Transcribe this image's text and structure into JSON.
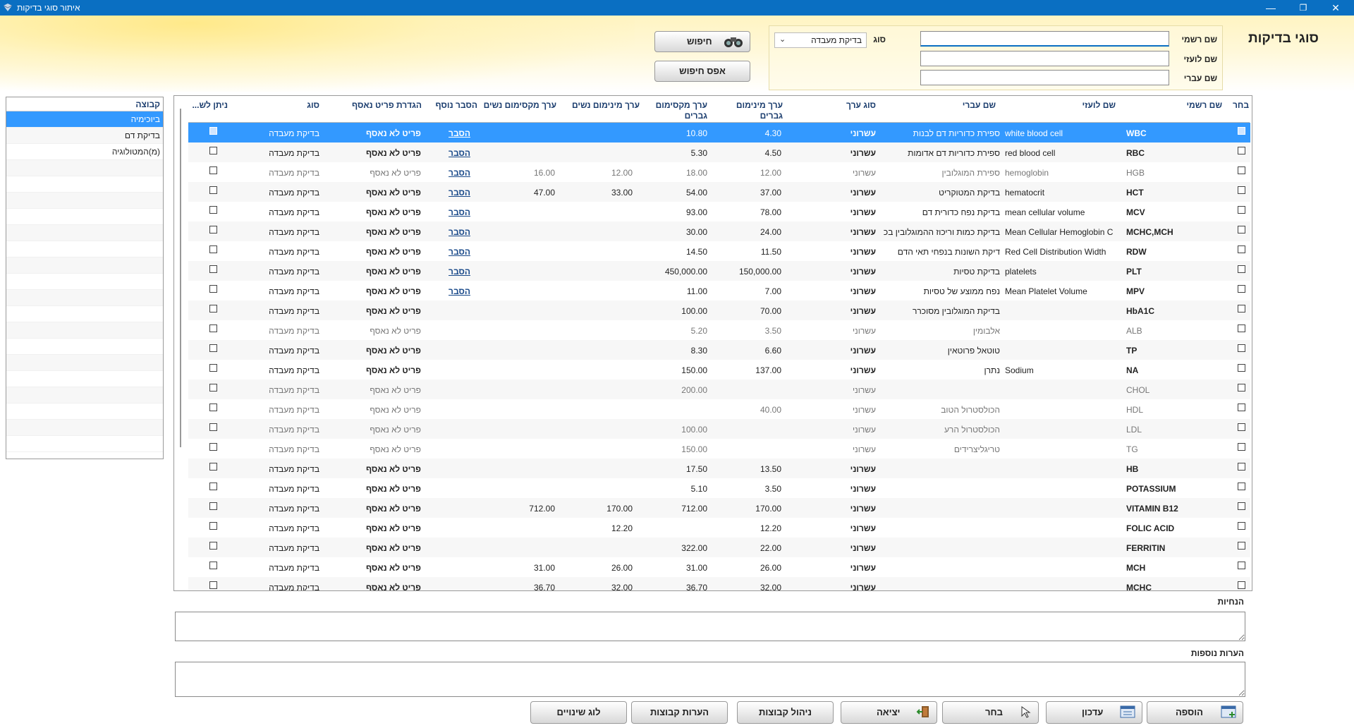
{
  "window": {
    "title": "איתור סוגי בדיקות",
    "minimize": "—",
    "maximize": "❐",
    "close": "✕"
  },
  "header": {
    "page_title": "סוגי בדיקות",
    "search": {
      "official_name_label": "שם רשמי",
      "foreign_name_label": "שם לועזי",
      "hebrew_name_label": "שם עברי",
      "type_label": "סוג",
      "type_value": "בדיקת מעבדה",
      "official_name_value": "",
      "foreign_name_value": "",
      "hebrew_name_value": ""
    },
    "search_button": "חיפוש",
    "reset_button": "אפס חיפוש"
  },
  "groups": {
    "header": "קבוצה",
    "items": [
      {
        "label": "ביוכימיה",
        "selected": true
      },
      {
        "label": "בדיקת דם",
        "selected": false
      },
      {
        "label": "(מ)המטולוגיה",
        "selected": false
      }
    ]
  },
  "grid": {
    "columns": {
      "select": "בחר",
      "official_name": "שם רשמי",
      "foreign_name": "שם לועזי",
      "hebrew_name": "שם עברי",
      "value_type": "סוג ערך",
      "min_men": "ערך מינימום גברים",
      "max_men": "ערך מקסימום גברים",
      "min_women": "ערך מינימום נשים",
      "max_women": "ערך מקסימום נשים",
      "extra_explain": "הסבר נוסף",
      "extra_item_def": "הגדרת פריט נאסף",
      "type": "סוג",
      "can_send": "ניתן לש..."
    },
    "rows": [
      {
        "official": "WBC",
        "foreign": "white blood cell",
        "hebrew": "ספירת כדוריות דם לבנות",
        "vtype": "עשרוני",
        "min_m": "4.30",
        "max_m": "10.80",
        "min_w": "",
        "max_w": "",
        "explain": "הסבר",
        "item": "פריט לא נאסף",
        "type": "בדיקת מעבדה",
        "dim": false,
        "sel": true
      },
      {
        "official": "RBC",
        "foreign": "red blood cell",
        "hebrew": "ספירת כדוריות דם אדומות",
        "vtype": "עשרוני",
        "min_m": "4.50",
        "max_m": "5.30",
        "min_w": "",
        "max_w": "",
        "explain": "הסבר",
        "item": "פריט לא נאסף",
        "type": "בדיקת מעבדה",
        "dim": false,
        "sel": false
      },
      {
        "official": "HGB",
        "foreign": "hemoglobin",
        "hebrew": "ספירת המוגלובין",
        "vtype": "עשרוני",
        "min_m": "12.00",
        "max_m": "18.00",
        "min_w": "12.00",
        "max_w": "16.00",
        "explain": "הסבר",
        "item": "פריט לא נאסף",
        "type": "בדיקת מעבדה",
        "dim": true,
        "sel": false
      },
      {
        "official": "HCT",
        "foreign": "hematocrit",
        "hebrew": "בדיקת המטוקריט",
        "vtype": "עשרוני",
        "min_m": "37.00",
        "max_m": "54.00",
        "min_w": "33.00",
        "max_w": "47.00",
        "explain": "הסבר",
        "item": "פריט לא נאסף",
        "type": "בדיקת מעבדה",
        "dim": false,
        "sel": false
      },
      {
        "official": "MCV",
        "foreign": "mean cellular volume",
        "hebrew": "בדיקת נפח כדורית דם",
        "vtype": "עשרוני",
        "min_m": "78.00",
        "max_m": "93.00",
        "min_w": "",
        "max_w": "",
        "explain": "הסבר",
        "item": "פריט לא נאסף",
        "type": "בדיקת מעבדה",
        "dim": false,
        "sel": false
      },
      {
        "official": "MCHC,MCH",
        "foreign": "Mean Cellular Hemoglobin C",
        "hebrew": "בדיקת כמות וריכוז ההמוגלובין בכ",
        "vtype": "עשרוני",
        "min_m": "24.00",
        "max_m": "30.00",
        "min_w": "",
        "max_w": "",
        "explain": "הסבר",
        "item": "פריט לא נאסף",
        "type": "בדיקת מעבדה",
        "dim": false,
        "sel": false
      },
      {
        "official": "RDW",
        "foreign": "Red Cell Distribution Width",
        "hebrew": "דיקת השונות בנפחי תאי הדם",
        "vtype": "עשרוני",
        "min_m": "11.50",
        "max_m": "14.50",
        "min_w": "",
        "max_w": "",
        "explain": "הסבר",
        "item": "פריט לא נאסף",
        "type": "בדיקת מעבדה",
        "dim": false,
        "sel": false
      },
      {
        "official": "PLT",
        "foreign": "platelets",
        "hebrew": "בדיקת טסיות",
        "vtype": "עשרוני",
        "min_m": "150,000.00",
        "max_m": "450,000.00",
        "min_w": "",
        "max_w": "",
        "explain": "הסבר",
        "item": "פריט לא נאסף",
        "type": "בדיקת מעבדה",
        "dim": false,
        "sel": false
      },
      {
        "official": "MPV",
        "foreign": "Mean Platelet Volume",
        "hebrew": "נפח ממוצע של טסיות",
        "vtype": "עשרוני",
        "min_m": "7.00",
        "max_m": "11.00",
        "min_w": "",
        "max_w": "",
        "explain": "הסבר",
        "item": "פריט לא נאסף",
        "type": "בדיקת מעבדה",
        "dim": false,
        "sel": false
      },
      {
        "official": "HbA1C",
        "foreign": "",
        "hebrew": "בדיקת המוגלובין מסוכרר",
        "vtype": "עשרוני",
        "min_m": "70.00",
        "max_m": "100.00",
        "min_w": "",
        "max_w": "",
        "explain": "",
        "item": "פריט לא נאסף",
        "type": "בדיקת מעבדה",
        "dim": false,
        "sel": false
      },
      {
        "official": "ALB",
        "foreign": "",
        "hebrew": "אלבומין",
        "vtype": "עשרוני",
        "min_m": "3.50",
        "max_m": "5.20",
        "min_w": "",
        "max_w": "",
        "explain": "",
        "item": "פריט לא נאסף",
        "type": "בדיקת מעבדה",
        "dim": true,
        "sel": false
      },
      {
        "official": "TP",
        "foreign": "",
        "hebrew": "טוטאל פרוטאין",
        "vtype": "עשרוני",
        "min_m": "6.60",
        "max_m": "8.30",
        "min_w": "",
        "max_w": "",
        "explain": "",
        "item": "פריט לא נאסף",
        "type": "בדיקת מעבדה",
        "dim": false,
        "sel": false
      },
      {
        "official": "NA",
        "foreign": "Sodium",
        "hebrew": "נתרן",
        "vtype": "עשרוני",
        "min_m": "137.00",
        "max_m": "150.00",
        "min_w": "",
        "max_w": "",
        "explain": "",
        "item": "פריט לא נאסף",
        "type": "בדיקת מעבדה",
        "dim": false,
        "sel": false
      },
      {
        "official": "CHOL",
        "foreign": "",
        "hebrew": "",
        "vtype": "עשרוני",
        "min_m": "",
        "max_m": "200.00",
        "min_w": "",
        "max_w": "",
        "explain": "",
        "item": "פריט לא נאסף",
        "type": "בדיקת מעבדה",
        "dim": true,
        "sel": false
      },
      {
        "official": "HDL",
        "foreign": "",
        "hebrew": "הכולסטרול הטוב",
        "vtype": "עשרוני",
        "min_m": "40.00",
        "max_m": "",
        "min_w": "",
        "max_w": "",
        "explain": "",
        "item": "פריט לא נאסף",
        "type": "בדיקת מעבדה",
        "dim": true,
        "sel": false
      },
      {
        "official": "LDL",
        "foreign": "",
        "hebrew": "הכולסטרול הרע",
        "vtype": "עשרוני",
        "min_m": "",
        "max_m": "100.00",
        "min_w": "",
        "max_w": "",
        "explain": "",
        "item": "פריט לא נאסף",
        "type": "בדיקת מעבדה",
        "dim": true,
        "sel": false
      },
      {
        "official": "TG",
        "foreign": "",
        "hebrew": "טריגליצרידים",
        "vtype": "עשרוני",
        "min_m": "",
        "max_m": "150.00",
        "min_w": "",
        "max_w": "",
        "explain": "",
        "item": "פריט לא נאסף",
        "type": "בדיקת מעבדה",
        "dim": true,
        "sel": false
      },
      {
        "official": "HB",
        "foreign": "",
        "hebrew": "",
        "vtype": "עשרוני",
        "min_m": "13.50",
        "max_m": "17.50",
        "min_w": "",
        "max_w": "",
        "explain": "",
        "item": "פריט לא נאסף",
        "type": "בדיקת מעבדה",
        "dim": false,
        "sel": false
      },
      {
        "official": "POTASSIUM",
        "foreign": "",
        "hebrew": "",
        "vtype": "עשרוני",
        "min_m": "3.50",
        "max_m": "5.10",
        "min_w": "",
        "max_w": "",
        "explain": "",
        "item": "פריט לא נאסף",
        "type": "בדיקת מעבדה",
        "dim": false,
        "sel": false
      },
      {
        "official": "VITAMIN B12",
        "foreign": "",
        "hebrew": "",
        "vtype": "עשרוני",
        "min_m": "170.00",
        "max_m": "712.00",
        "min_w": "170.00",
        "max_w": "712.00",
        "explain": "",
        "item": "פריט לא נאסף",
        "type": "בדיקת מעבדה",
        "dim": false,
        "sel": false
      },
      {
        "official": "FOLIC ACID",
        "foreign": "",
        "hebrew": "",
        "vtype": "עשרוני",
        "min_m": "12.20",
        "max_m": "",
        "min_w": "12.20",
        "max_w": "",
        "explain": "",
        "item": "פריט לא נאסף",
        "type": "בדיקת מעבדה",
        "dim": false,
        "sel": false
      },
      {
        "official": "FERRITIN",
        "foreign": "",
        "hebrew": "",
        "vtype": "עשרוני",
        "min_m": "22.00",
        "max_m": "322.00",
        "min_w": "",
        "max_w": "",
        "explain": "",
        "item": "פריט לא נאסף",
        "type": "בדיקת מעבדה",
        "dim": false,
        "sel": false
      },
      {
        "official": "MCH",
        "foreign": "",
        "hebrew": "",
        "vtype": "עשרוני",
        "min_m": "26.00",
        "max_m": "31.00",
        "min_w": "26.00",
        "max_w": "31.00",
        "explain": "",
        "item": "פריט לא נאסף",
        "type": "בדיקת מעבדה",
        "dim": false,
        "sel": false
      },
      {
        "official": "MCHC",
        "foreign": "",
        "hebrew": "",
        "vtype": "עשרוני",
        "min_m": "32.00",
        "max_m": "36.70",
        "min_w": "32.00",
        "max_w": "36.70",
        "explain": "",
        "item": "פריט לא נאסף",
        "type": "בדיקת מעבדה",
        "dim": false,
        "sel": false
      }
    ]
  },
  "instructions_label": "הנחיות",
  "notes_label": "הערות נוספות",
  "bottom_buttons": {
    "add": "הוספה",
    "update": "עדכון",
    "select": "בחר",
    "exit": "יציאה",
    "manage_groups": "ניהול קבוצות",
    "group_notes": "הערות קבוצות",
    "change_log": "לוג שינויים"
  }
}
